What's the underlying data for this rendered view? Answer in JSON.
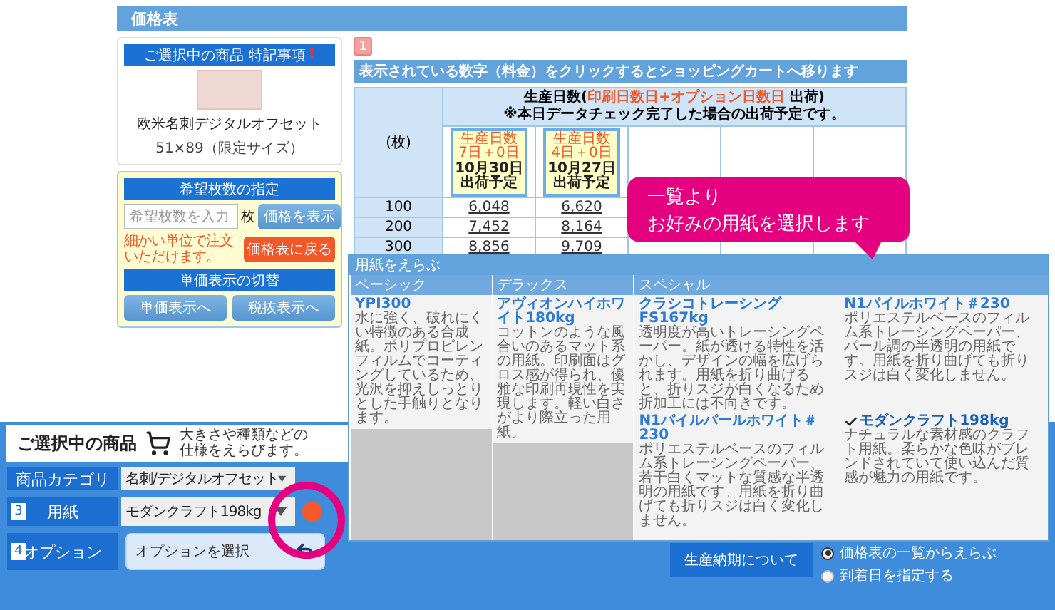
{
  "page_title": "価格表",
  "notice_card": {
    "title": "ご選択中の商品 特記事項",
    "alert_mark": "!",
    "product_name": "欧米名刺デジタルオフセット",
    "product_size": "51×89（限定サイズ）"
  },
  "quantity_card": {
    "title": "希望枚数の指定",
    "input": {
      "placeholder": "希望枚数を入力"
    },
    "unit": "枚",
    "show_price_button": "価格を表示",
    "note": "細かい単位で注文いただけます。",
    "back_button": "価格表に戻る",
    "switch_title": "単価表示の切替",
    "switch_buttons": [
      "単価表示へ",
      "税抜表示へ"
    ]
  },
  "step_badge": "1",
  "info_bar": "表示されている数字（料金）をクリックするとショッピングカートへ移ります",
  "price_table": {
    "corner": "(枚)",
    "heading_prefix": "生産日数(",
    "heading_highlight": "印刷日数日+オプション日数日",
    "heading_suffix": " 出荷)",
    "note": "※本日データチェック完了した場合の出荷予定です。",
    "schedules": [
      {
        "label": "生産日数",
        "days": "7日＋0日",
        "date": "10月30日",
        "status": "出荷予定"
      },
      {
        "label": "生産日数",
        "days": "4日＋0日",
        "date": "10月27日",
        "status": "出荷予定"
      }
    ],
    "rows": [
      {
        "qty": "100",
        "prices": [
          "6,048",
          "6,620"
        ]
      },
      {
        "qty": "200",
        "prices": [
          "7,452",
          "8,164"
        ]
      },
      {
        "qty": "300",
        "prices": [
          "8,856",
          "9,709"
        ]
      }
    ]
  },
  "callout": {
    "lines": [
      "一覧より",
      "お好みの用紙を選択します"
    ]
  },
  "paper_dialog": {
    "title": "用紙をえらぶ",
    "columns": [
      {
        "heading": "ベーシック",
        "items": [
          {
            "name": "YPI300",
            "description": "水に強く、破れにくい特徴のある合成紙。ポリプロピレンフィルムでコーティングしているため、光沢を抑えしっとりとした手触りとなります。",
            "selected": false
          }
        ]
      },
      {
        "heading": "デラックス",
        "items": [
          {
            "name": "アヴィオンハイホワイト180kg",
            "description": "コットンのような風合いのあるマット系の用紙。印刷面はグロス感が得られ、優雅な印刷再現性を実現します。軽い白さがより際立った用紙。",
            "selected": false
          }
        ]
      },
      {
        "heading": "スペシャル",
        "items": [
          {
            "name": "クラシコトレーシングFS167kg",
            "description": "透明度が高いトレーシングペーパー。紙が透ける特性を活かし、デザインの幅を広げられます。用紙を折り曲げると、折りスジが白くなるため折加工には不向きです。",
            "selected": false
          },
          {
            "name": "N1パイルホワイト＃230",
            "description": "ポリエステルベースのフィルム系トレーシングペーパー、パール調の半透明の用紙です。用紙を折り曲げても折りスジは白く変化しません。",
            "selected": false
          },
          {
            "name": "N1パイルパールホワイト＃230",
            "description": "ポリエステルベースのフィルム系トレーシングペーパー、若干白くマットな質感な半透明の用紙です。用紙を折り曲げても折りスジは白く変化しません。",
            "selected": false
          },
          {
            "name": "モダンクラフト198kg",
            "description": "ナチュラルな素材感のクラフト用紙。柔らかな色味がブレンドされていて使い込んだ質感が魅力の用紙です。",
            "selected": true
          }
        ]
      }
    ]
  },
  "selection_panel": {
    "heading": "ご選択中の商品",
    "description": "大きさや種類などの仕様をえらびます。",
    "fields": [
      {
        "kind": "select",
        "label": "商品カテゴリ",
        "value": "名刺/デジタルオフセット"
      },
      {
        "kind": "select",
        "step": "3",
        "label": "用紙",
        "value": "モダンクラフト198kg",
        "badge": true
      },
      {
        "kind": "option",
        "step": "4",
        "label": "オプション",
        "value": "オプションを選択"
      }
    ],
    "delivery_button": "生産納期について",
    "delivery_modes": [
      {
        "label": "価格表の一覧からえらぶ",
        "selected": true
      },
      {
        "label": "到着日を指定する",
        "selected": false
      }
    ]
  }
}
